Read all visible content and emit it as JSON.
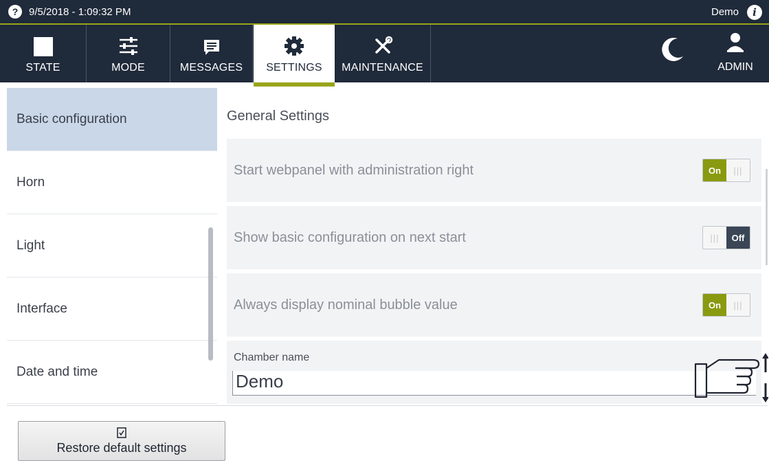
{
  "statusbar": {
    "help_icon": "?",
    "datetime": "9/5/2018 - 1:09:32 PM",
    "user": "Demo",
    "info_icon": "i"
  },
  "nav": {
    "tabs": [
      {
        "label": "STATE",
        "icon": "square-icon"
      },
      {
        "label": "MODE",
        "icon": "sliders-icon"
      },
      {
        "label": "MESSAGES",
        "icon": "message-icon"
      },
      {
        "label": "SETTINGS",
        "icon": "gear-icon",
        "active": true
      },
      {
        "label": "MAINTENANCE",
        "icon": "tools-icon"
      }
    ],
    "night_mode_icon": "moon-icon",
    "admin_label": "ADMIN",
    "admin_icon": "user-icon",
    "accent_color": "#9aa51a",
    "bar_color": "#1f2a3a"
  },
  "sidebar": {
    "items": [
      {
        "label": "Basic configuration",
        "active": true
      },
      {
        "label": "Horn"
      },
      {
        "label": "Light"
      },
      {
        "label": "Interface"
      },
      {
        "label": "Date and time"
      }
    ]
  },
  "main": {
    "section_title": "General Settings",
    "settings": [
      {
        "label": "Start webpanel with administration right",
        "state": "On"
      },
      {
        "label": "Show basic configuration on next start",
        "state": "Off"
      },
      {
        "label": "Always display nominal bubble value",
        "state": "On"
      }
    ],
    "chamber": {
      "label": "Chamber name",
      "value": "Demo"
    }
  },
  "footer": {
    "restore_label": "Restore default settings",
    "restore_icon": "checklist-icon"
  }
}
